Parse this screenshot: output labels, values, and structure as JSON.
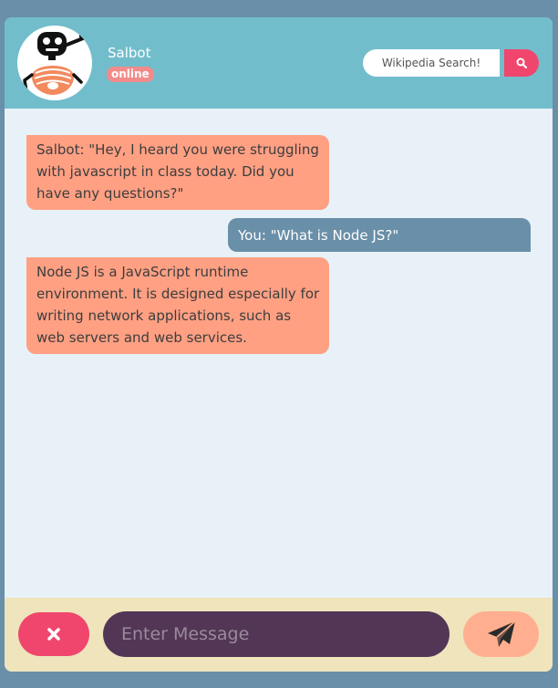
{
  "header": {
    "bot_name": "Salbot",
    "status": "online",
    "search_placeholder": "Wikipedia Search!",
    "search_icon": "search-icon"
  },
  "messages": [
    {
      "sender": "bot",
      "text": "Salbot: \"Hey, I heard you were struggling with javascript in class today. Did you have any questions?\""
    },
    {
      "sender": "user",
      "text": "You: \"What is Node JS?\""
    },
    {
      "sender": "bot",
      "text": "Node JS is a JavaScript runtime environment. It is designed especially for writing network applications, such as web servers and web services."
    }
  ],
  "footer": {
    "cancel_icon": "close-icon",
    "input_placeholder": "Enter Message",
    "send_icon": "paper-plane-icon"
  },
  "colors": {
    "page_bg": "#6a8fa8",
    "header_bg": "#72bdcb",
    "chat_bg": "#e8f1f8",
    "bot_bubble": "#ffa083",
    "user_bubble": "#6a8fa8",
    "footer_bg": "#efe4bc",
    "accent_red": "#f0466d",
    "input_bg": "#533656",
    "send_bg": "#ffaf8f",
    "status_badge": "#f28b8b"
  }
}
